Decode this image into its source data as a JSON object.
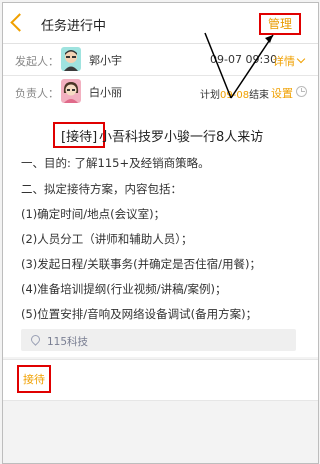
{
  "header": {
    "title": "任务进行中",
    "manage_label": "管理"
  },
  "initiator": {
    "label": "发起人：",
    "name": "郭小宇",
    "time": "09-07 09:30",
    "detail_label": "详情"
  },
  "owner": {
    "label": "负责人：",
    "name": "白小丽",
    "plan_prefix": "计划",
    "plan_date": "09-08",
    "plan_suffix": "结束",
    "settings_label": "设置"
  },
  "task": {
    "tag": "[接待]",
    "title": "小吾科技罗小骏一行8人来访",
    "lines": [
      "一、目的: 了解115+及经销商策略。",
      "二、拟定接待方案，内容包括：",
      "(1)确定时间/地点(会议室)；",
      "(2)人员分工（讲师和辅助人员）；",
      "(3)发起日程/关联事务(并确定是否住宿/用餐)；",
      "(4)准备培训提纲(行业视频/讲稿/案例)；",
      "(5)位置安排/音响及网络设备调试(备用方案)；"
    ],
    "location": "115科技"
  },
  "tags": {
    "item": "接待"
  },
  "icons": {
    "back": "back-arrow-icon",
    "chevron": "chevron-down-icon",
    "clock": "clock-icon",
    "pin": "location-pin-icon"
  },
  "colors": {
    "accent": "#f0a000",
    "highlight": "#e00000"
  }
}
